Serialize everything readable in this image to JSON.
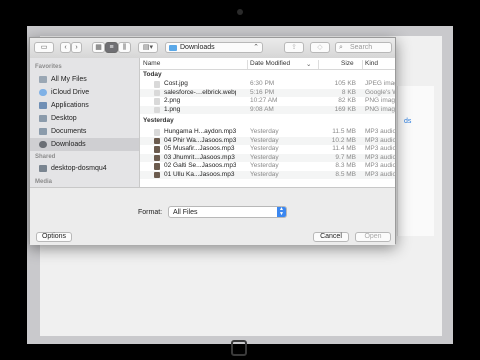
{
  "toolbar": {
    "current_folder": "Downloads",
    "search_placeholder": "Search",
    "new_folder_label": "+"
  },
  "sidebar": {
    "favorites_heading": "Favorites",
    "favorites": [
      {
        "label": "All My Files",
        "icon": "all-files-icon",
        "color": "#9aa7b4"
      },
      {
        "label": "iCloud Drive",
        "icon": "cloud-icon",
        "color": "#7fb1e6"
      },
      {
        "label": "Applications",
        "icon": "applications-icon",
        "color": "#6f8fb5"
      },
      {
        "label": "Desktop",
        "icon": "desktop-icon",
        "color": "#8b9bab"
      },
      {
        "label": "Documents",
        "icon": "documents-icon",
        "color": "#8b9bab"
      },
      {
        "label": "Downloads",
        "icon": "downloads-icon",
        "color": "#6b6f75",
        "selected": true
      }
    ],
    "shared_heading": "Shared",
    "shared": [
      {
        "label": "desktop-dosmqu4",
        "icon": "computer-icon",
        "color": "#7a8590"
      }
    ],
    "media_heading": "Media"
  },
  "columns": {
    "name": "Name",
    "date": "Date Modified",
    "size": "Size",
    "kind": "Kind"
  },
  "groups": [
    {
      "heading": "Today",
      "files": [
        {
          "name": "Cost.jpg",
          "date": "6:30 PM",
          "size": "105 KB",
          "kind": "JPEG image",
          "icon_color": "#d9d9d9"
        },
        {
          "name": "salesforce-…elbrick.webp",
          "date": "5:16 PM",
          "size": "8 KB",
          "kind": "Google's W",
          "icon_color": "#d9d9d9"
        },
        {
          "name": "2.png",
          "date": "10:27 AM",
          "size": "82 KB",
          "kind": "PNG image",
          "icon_color": "#d9d9d9"
        },
        {
          "name": "1.png",
          "date": "9:08 AM",
          "size": "169 KB",
          "kind": "PNG image",
          "icon_color": "#d9d9d9"
        }
      ]
    },
    {
      "heading": "Yesterday",
      "files": [
        {
          "name": "Hungama H...aydon.mp3",
          "date": "Yesterday",
          "size": "11.5 MB",
          "kind": "MP3 audio",
          "icon_color": "#d9d9d9"
        },
        {
          "name": "04 Phir Wa...Jasoos.mp3",
          "date": "Yesterday",
          "size": "10.2 MB",
          "kind": "MP3 audio",
          "icon_color": "#6b5b4e"
        },
        {
          "name": "05 Musafir...Jasoos.mp3",
          "date": "Yesterday",
          "size": "11.4 MB",
          "kind": "MP3 audio",
          "icon_color": "#6b5b4e"
        },
        {
          "name": "03 Jhumrit...Jasoos.mp3",
          "date": "Yesterday",
          "size": "9.7 MB",
          "kind": "MP3 audio",
          "icon_color": "#6b5b4e"
        },
        {
          "name": "02 Galti Se...Jasoos.mp3",
          "date": "Yesterday",
          "size": "8.3 MB",
          "kind": "MP3 audio",
          "icon_color": "#6b5b4e"
        },
        {
          "name": "01 Ullu Ka...Jasoos.mp3",
          "date": "Yesterday",
          "size": "8.5 MB",
          "kind": "MP3 audio",
          "icon_color": "#6b5b4e"
        }
      ]
    }
  ],
  "format": {
    "label": "Format:",
    "value": "All Files"
  },
  "buttons": {
    "options": "Options",
    "cancel": "Cancel",
    "open": "Open"
  },
  "background_link": "ds"
}
